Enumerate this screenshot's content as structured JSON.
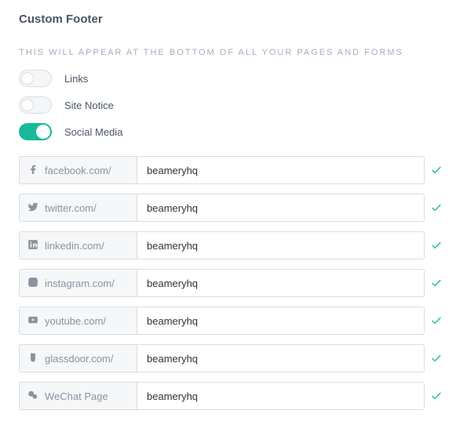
{
  "section": {
    "title": "Custom Footer",
    "subtitle": "THIS WILL APPEAR AT THE BOTTOM OF ALL YOUR PAGES AND FORMS"
  },
  "toggles": {
    "links": {
      "label": "Links",
      "enabled": false
    },
    "site_notice": {
      "label": "Site Notice",
      "enabled": false
    },
    "social_media": {
      "label": "Social Media",
      "enabled": true
    }
  },
  "social_fields": [
    {
      "icon": "facebook",
      "prefix": "facebook.com/",
      "value": "beameryhq",
      "valid": true
    },
    {
      "icon": "twitter",
      "prefix": "twitter.com/",
      "value": "beameryhq",
      "valid": true
    },
    {
      "icon": "linkedin",
      "prefix": "linkedin.com/",
      "value": "beameryhq",
      "valid": true
    },
    {
      "icon": "instagram",
      "prefix": "instagram.com/",
      "value": "beameryhq",
      "valid": true
    },
    {
      "icon": "youtube",
      "prefix": "youtube.com/",
      "value": "beameryhq",
      "valid": true
    },
    {
      "icon": "glassdoor",
      "prefix": "glassdoor.com/",
      "value": "beameryhq",
      "valid": true
    },
    {
      "icon": "wechat",
      "prefix": "WeChat Page",
      "value": "beameryhq",
      "valid": true
    }
  ]
}
